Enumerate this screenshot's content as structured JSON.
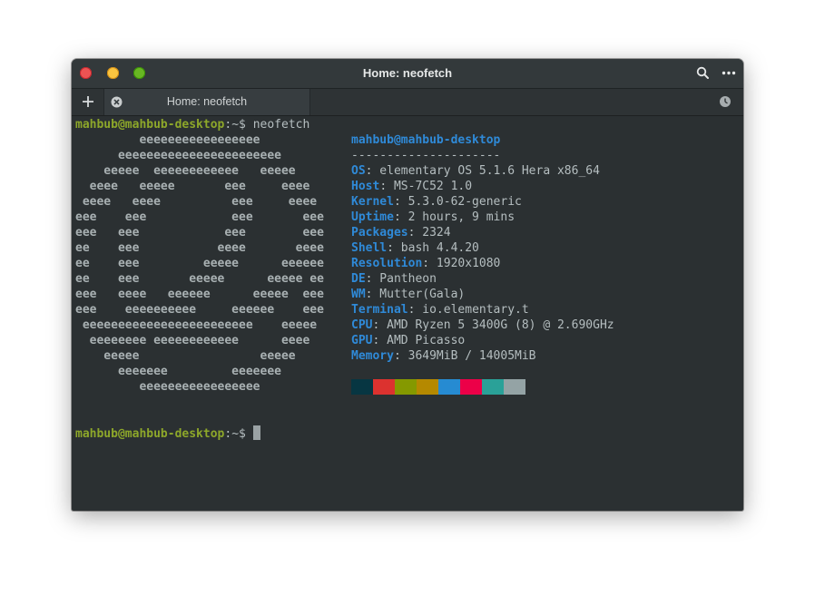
{
  "window": {
    "title": "Home: neofetch",
    "controls": {
      "close_color": "#ed5353",
      "minimize_color": "#f9c440",
      "maximize_color": "#68b723"
    }
  },
  "tabs": [
    {
      "label": "Home: neofetch"
    }
  ],
  "terminal": {
    "prompt_user": "mahbub@mahbub-desktop",
    "prompt_path": ":~",
    "prompt_symbol": "$ ",
    "command": "neofetch",
    "ascii_art": [
      "         eeeeeeeeeeeeeeeee",
      "      eeeeeeeeeeeeeeeeeeeeeee",
      "    eeeee  eeeeeeeeeeee   eeeee",
      "  eeee   eeeee       eee     eeee",
      " eeee   eeee          eee     eeee",
      "eee    eee            eee       eee",
      "eee   eee            eee        eee",
      "ee    eee           eeee       eeee",
      "ee    eee         eeeee      eeeeee",
      "ee    eee       eeeee      eeeee ee",
      "eee   eeee   eeeeee      eeeee  eee",
      "eee    eeeeeeeeee     eeeeee    eee",
      " eeeeeeeeeeeeeeeeeeeeeeee    eeeee",
      "  eeeeeeee eeeeeeeeeeee      eeee",
      "    eeeee                 eeeee",
      "      eeeeeee         eeeeeee",
      "         eeeeeeeeeeeeeeeee"
    ],
    "info_title": "mahbub@mahbub-desktop",
    "separator": "---------------------",
    "info": [
      {
        "key": "OS",
        "value": ": elementary OS 5.1.6 Hera x86_64"
      },
      {
        "key": "Host",
        "value": ": MS-7C52 1.0"
      },
      {
        "key": "Kernel",
        "value": ": 5.3.0-62-generic"
      },
      {
        "key": "Uptime",
        "value": ": 2 hours, 9 mins"
      },
      {
        "key": "Packages",
        "value": ": 2324"
      },
      {
        "key": "Shell",
        "value": ": bash 4.4.20"
      },
      {
        "key": "Resolution",
        "value": ": 1920x1080"
      },
      {
        "key": "DE",
        "value": ": Pantheon"
      },
      {
        "key": "WM",
        "value": ": Mutter(Gala)"
      },
      {
        "key": "Terminal",
        "value": ": io.elementary.t"
      },
      {
        "key": "CPU",
        "value": ": AMD Ryzen 5 3400G (8) @ 2.690GHz"
      },
      {
        "key": "GPU",
        "value": ": AMD Picasso"
      },
      {
        "key": "Memory",
        "value": ": 3649MiB / 14005MiB"
      }
    ],
    "color_swatches": [
      "#073642",
      "#dc322f",
      "#859900",
      "#b58900",
      "#268bd2",
      "#ec0048",
      "#2aa198",
      "#94a3a5"
    ]
  },
  "colors": {
    "prompt_user": "#8da72a",
    "info_key": "#2f8ad8",
    "background": "#2b3032"
  },
  "icons": {
    "search": "search-icon",
    "more": "more-icon",
    "new_tab": "plus-icon",
    "tab_close": "close-icon",
    "history": "history-icon"
  }
}
